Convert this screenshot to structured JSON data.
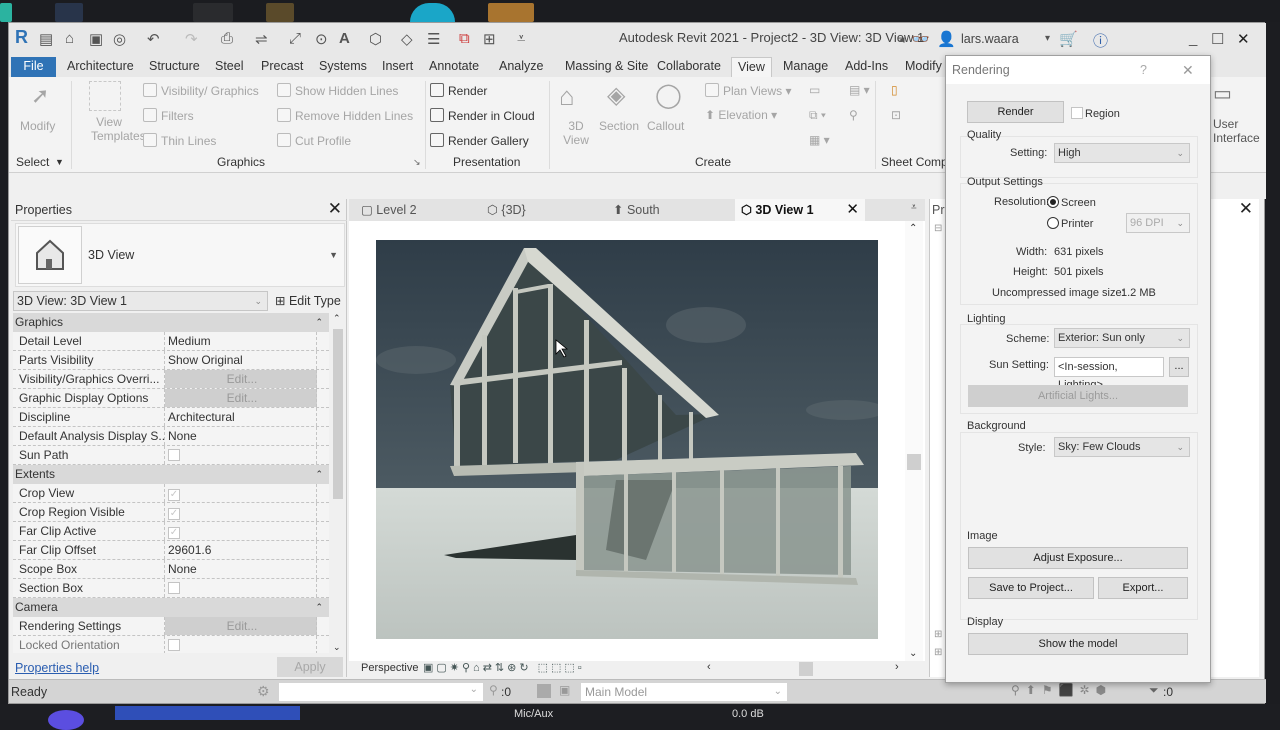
{
  "window": {
    "title": "Autodesk Revit 2021 - Project2 - 3D View: 3D View 1",
    "user": "lars.waara",
    "controls": {
      "minimize": "_",
      "maximize": "☐",
      "close": "✕"
    }
  },
  "ribbon_tabs": [
    {
      "label": "File"
    },
    {
      "label": "Architecture"
    },
    {
      "label": "Structure"
    },
    {
      "label": "Steel"
    },
    {
      "label": "Precast"
    },
    {
      "label": "Systems"
    },
    {
      "label": "Insert"
    },
    {
      "label": "Annotate"
    },
    {
      "label": "Analyze"
    },
    {
      "label": "Massing & Site"
    },
    {
      "label": "Collaborate"
    },
    {
      "label": "View"
    },
    {
      "label": "Manage"
    },
    {
      "label": "Add-Ins"
    },
    {
      "label": "Modify"
    }
  ],
  "active_tab": "View",
  "ribbon": {
    "select": {
      "modify": "Modify",
      "panel": "Select"
    },
    "graphics": {
      "view_templates": "View Templates",
      "visibility_graphics": "Visibility/ Graphics",
      "filters": "Filters",
      "thin_lines": "Thin Lines",
      "show_hidden_lines": "Show Hidden Lines",
      "remove_hidden_lines": "Remove Hidden Lines",
      "cut_profile": "Cut Profile",
      "panel": "Graphics"
    },
    "presentation": {
      "render": "Render",
      "render_in_cloud": "Render in Cloud",
      "render_gallery": "Render Gallery",
      "panel": "Presentation"
    },
    "create": {
      "view_3d": "3D View",
      "section": "Section",
      "callout": "Callout",
      "plan_views": "Plan Views",
      "elevation": "Elevation",
      "panel": "Create"
    },
    "sheet_composition": {
      "panel": "Sheet Comp"
    },
    "user_interface": {
      "label": "User Interface"
    }
  },
  "properties": {
    "title": "Properties",
    "type_name": "3D View",
    "view_selector": "3D View: 3D View 1",
    "edit_type": "Edit Type",
    "groups": [
      {
        "name": "Graphics",
        "rows": [
          {
            "key": "Detail Level",
            "value": "Medium",
            "kind": "text"
          },
          {
            "key": "Parts Visibility",
            "value": "Show Original",
            "kind": "text"
          },
          {
            "key": "Visibility/Graphics Overri...",
            "value": "Edit...",
            "kind": "button"
          },
          {
            "key": "Graphic Display Options",
            "value": "Edit...",
            "kind": "button"
          },
          {
            "key": "Discipline",
            "value": "Architectural",
            "kind": "text"
          },
          {
            "key": "Default Analysis Display S...",
            "value": "None",
            "kind": "text"
          },
          {
            "key": "Sun Path",
            "value": false,
            "kind": "checkbox"
          }
        ]
      },
      {
        "name": "Extents",
        "rows": [
          {
            "key": "Crop View",
            "value": true,
            "kind": "checkbox"
          },
          {
            "key": "Crop Region Visible",
            "value": true,
            "kind": "checkbox"
          },
          {
            "key": "Far Clip Active",
            "value": true,
            "kind": "checkbox"
          },
          {
            "key": "Far Clip Offset",
            "value": "29601.6",
            "kind": "text"
          },
          {
            "key": "Scope Box",
            "value": "None",
            "kind": "text"
          },
          {
            "key": "Section Box",
            "value": false,
            "kind": "checkbox"
          }
        ]
      },
      {
        "name": "Camera",
        "rows": [
          {
            "key": "Rendering Settings",
            "value": "Edit...",
            "kind": "button"
          },
          {
            "key": "Locked Orientation",
            "value": false,
            "kind": "checkbox"
          }
        ]
      }
    ],
    "help_link": "Properties help",
    "apply": "Apply"
  },
  "view_tabs": [
    {
      "label": "Level 2",
      "icon": "floor-plan-icon",
      "active": false
    },
    {
      "label": "{3D}",
      "icon": "3d-house-icon",
      "active": false
    },
    {
      "label": "South",
      "icon": "elevation-icon",
      "active": true
    },
    {
      "label": "3D View 1",
      "icon": "3d-house-icon",
      "active": true
    }
  ],
  "view_control_bar": {
    "projection": "Perspective"
  },
  "project_browser": {
    "title_partial": "Pro"
  },
  "status_bar": {
    "status": "Ready",
    "selection_count": ":0",
    "model": "Main Model",
    "filter_count": ":0"
  },
  "rendering_dialog": {
    "title": "Rendering",
    "help": "?",
    "render_button": "Render",
    "region_label": "Region",
    "region_checked": false,
    "quality": {
      "label": "Quality",
      "setting_label": "Setting:",
      "setting": "High"
    },
    "output": {
      "label": "Output Settings",
      "resolution_label": "Resolution:",
      "screen": "Screen",
      "printer": "Printer",
      "resolution_selected": "Screen",
      "dpi": "96 DPI",
      "width_label": "Width:",
      "width": "631 pixels",
      "height_label": "Height:",
      "height": "501 pixels",
      "size_label": "Uncompressed image size:",
      "size": "1.2 MB"
    },
    "lighting": {
      "label": "Lighting",
      "scheme_label": "Scheme:",
      "scheme": "Exterior: Sun only",
      "sun_label": "Sun Setting:",
      "sun": "<In-session, Lighting>",
      "browse": "...",
      "artificial": "Artificial Lights..."
    },
    "background": {
      "label": "Background",
      "style_label": "Style:",
      "style": "Sky: Few Clouds"
    },
    "image": {
      "label": "Image",
      "adjust": "Adjust Exposure...",
      "save": "Save to Project...",
      "export": "Export..."
    },
    "display": {
      "label": "Display",
      "show_model": "Show the model"
    }
  },
  "taskbar": {
    "mixer_label": "Mic/Aux",
    "mixer_level": "0.0 dB"
  }
}
